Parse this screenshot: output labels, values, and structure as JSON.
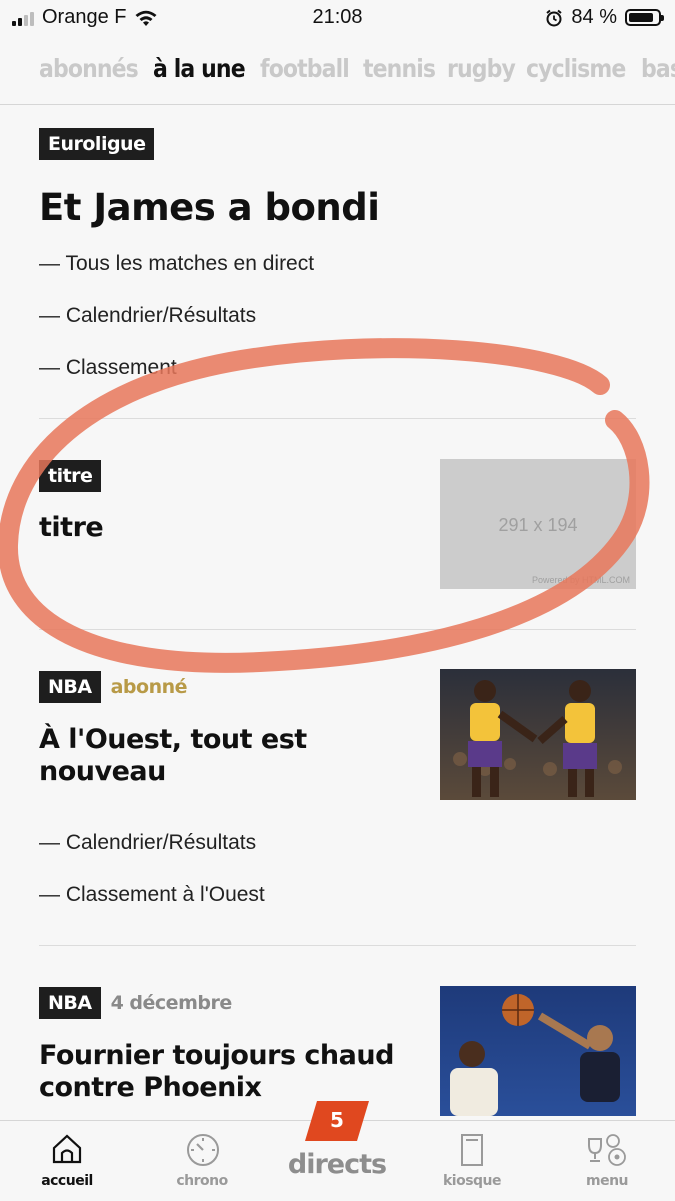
{
  "status_bar": {
    "carrier": "Orange F",
    "time": "21:08",
    "battery_percent": "84 %",
    "battery_level": 0.84
  },
  "categories": [
    {
      "label": "abonnés",
      "active": false
    },
    {
      "label": "à la une",
      "active": true
    },
    {
      "label": "football",
      "active": false
    },
    {
      "label": "tennis",
      "active": false
    },
    {
      "label": "rugby",
      "active": false
    },
    {
      "label": "cyclisme",
      "active": false
    },
    {
      "label": "basket",
      "active": false
    }
  ],
  "articles": [
    {
      "tag": "Euroligue",
      "title": "Et James a bondi",
      "links": [
        "— Tous les matches en direct",
        "— Calendrier/Résultats",
        "— Classement"
      ]
    },
    {
      "tag": "titre",
      "title": "titre",
      "image_placeholder": {
        "size_text": "291 x 194",
        "powered_text": "Powered by HTML.COM"
      }
    },
    {
      "tag": "NBA",
      "meta": "abonné",
      "title_line1": "À l'Ouest, tout est",
      "title_line2": "nouveau",
      "links": [
        "— Calendrier/Résultats",
        "— Classement à l'Ouest"
      ]
    },
    {
      "tag": "NBA",
      "meta": "4 décembre",
      "title_line1": "Fournier toujours chaud",
      "title_line2": "contre Phoenix"
    }
  ],
  "tabbar": {
    "home": "accueil",
    "chrono": "chrono",
    "directs": "directs",
    "directs_count": "5",
    "kiosque": "kiosque",
    "menu": "menu"
  },
  "colors": {
    "accent_red": "#e0481f",
    "subscriber_gold": "#b89a47",
    "annotation": "#e8775a"
  }
}
